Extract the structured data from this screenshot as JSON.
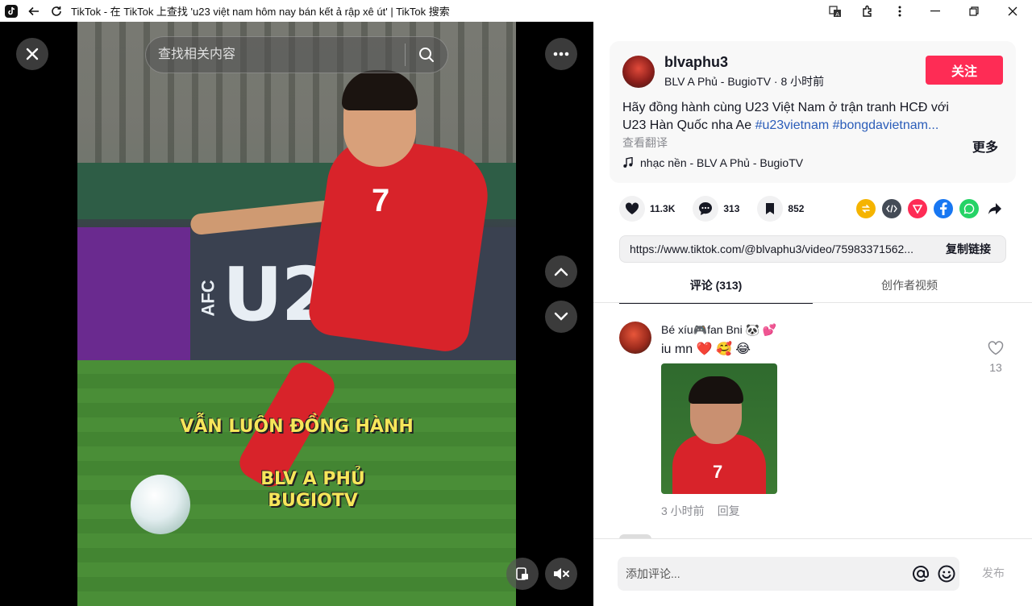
{
  "browser": {
    "title": "TikTok - 在 TikTok 上查找 'u23 việt nam hôm nay bán kết ả rập xê út' | TikTok 搜索"
  },
  "video": {
    "search_placeholder": "查找相关内容",
    "overlay_line1": "VẪN LUÔN ĐỒNG HÀNH",
    "overlay_line2": "BLV A PHỦ",
    "overlay_line3": "BUGIOTV",
    "board_text": "U23",
    "board_side_text": "AFC",
    "jersey_number": "7"
  },
  "post": {
    "username": "blvaphu3",
    "subline": "BLV A Phủ - BugioTV · 8 小时前",
    "follow_label": "关注",
    "description_text": "Hãy đồng hành cùng U23 Việt Nam ở trận tranh HCĐ với U23 Hàn Quốc nha Ae ",
    "tag1": "#u23vietnam",
    "tag2": "#bongdavietnam...",
    "more_label": "更多",
    "translate_label": "查看翻译",
    "music": "nhạc nền - BLV A Phủ - BugioTV"
  },
  "actions": {
    "likes": "11.3K",
    "comments": "313",
    "saves": "852"
  },
  "share_colors": {
    "repost": "#f5b400",
    "embed": "#444b56",
    "friends": "#fe2c55",
    "facebook": "#1877f2",
    "whatsapp": "#25d366"
  },
  "link": {
    "url": "https://www.tiktok.com/@blvaphu3/video/75983371562...",
    "copy_label": "复制链接"
  },
  "tabs": {
    "comments": "评论 (313)",
    "creator": "创作者视频"
  },
  "comment": {
    "name": "Bé xíu🎮fan Bni 🐼 💕",
    "text": "iu mn ❤️ 🥰 😂",
    "image_number": "7",
    "time": "3 小时前",
    "reply": "回复",
    "like_count": "13"
  },
  "footer": {
    "placeholder": "添加评论...",
    "post_label": "发布"
  }
}
